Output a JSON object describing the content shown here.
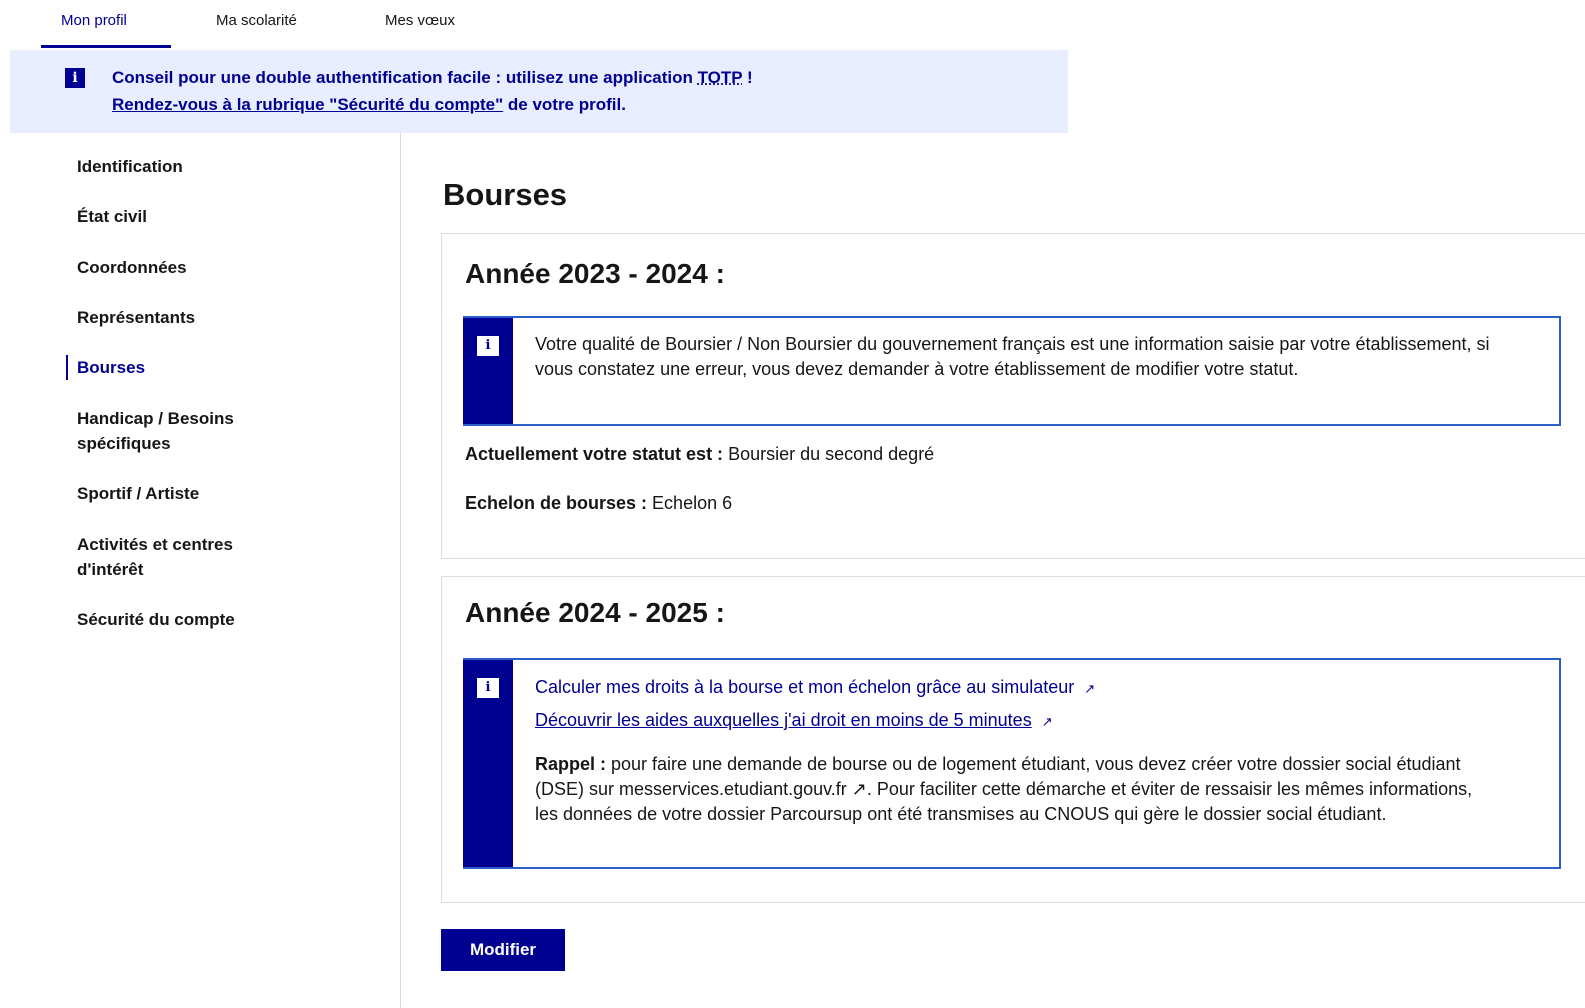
{
  "tabs": [
    {
      "label": "Mon profil"
    },
    {
      "label": "Ma scolarité"
    },
    {
      "label": "Mes vœux"
    }
  ],
  "notice": {
    "line1_prefix": "Conseil pour une double authentification facile : utilisez une application ",
    "line1_link": "TOTP",
    "line1_suffix": " !",
    "line2_link": "Rendez-vous à la rubrique \"Sécurité du compte\"",
    "line2_suffix": " de votre profil."
  },
  "sidebar": {
    "items": [
      {
        "label": "Identification"
      },
      {
        "label": "État civil"
      },
      {
        "label": "Coordonnées"
      },
      {
        "label": "Représentants"
      },
      {
        "label": "Bourses"
      },
      {
        "label": "Handicap / Besoins spécifiques"
      },
      {
        "label": "Sportif / Artiste"
      },
      {
        "label": "Activités et centres d'intérêt"
      },
      {
        "label": "Sécurité du compte"
      }
    ]
  },
  "main": {
    "title": "Bourses",
    "year1": {
      "title": "Année 2023 - 2024 :",
      "callout_text": "Votre qualité de Boursier / Non Boursier du gouvernement français est une information saisie par votre établissement, si vous constatez une erreur, vous devez demander à votre établissement de modifier votre statut.",
      "status_label": "Actuellement votre statut est :",
      "status_value": " Boursier du second degré",
      "echelon_label": "Echelon de bourses :",
      "echelon_value": " Echelon 6"
    },
    "year2": {
      "title": "Année 2024 - 2025 :",
      "link1": "Calculer mes droits à la bourse et mon échelon grâce au simulateur",
      "link2": "Découvrir les aides auxquelles j'ai droit en moins de 5 minutes",
      "reminder_label": "Rappel :",
      "reminder_text": " pour faire une demande de bourse ou de logement étudiant, vous devez créer votre dossier social étudiant (DSE) sur messervices.etudiant.gouv.fr ↗. Pour faciliter cette démarche et éviter de ressaisir les mêmes informations, les données de votre dossier Parcoursup ont été transmises au CNOUS qui gère le dossier social étudiant."
    },
    "modify_button": "Modifier"
  },
  "colors": {
    "accent": "#000091",
    "notice_bg": "#e8edff",
    "callout_border": "#2c5cc5"
  }
}
